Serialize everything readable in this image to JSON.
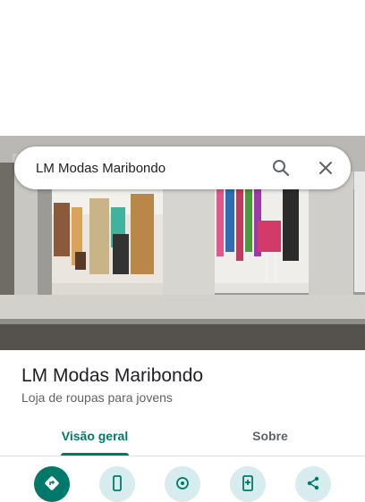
{
  "search": {
    "query": "LM Modas Maribondo"
  },
  "place": {
    "name": "LM Modas Maribondo",
    "category": "Loja de roupas para jovens"
  },
  "tabs": [
    {
      "label": "Visão geral",
      "active": true
    },
    {
      "label": "Sobre",
      "active": false
    }
  ],
  "actions": [
    {
      "icon": "directions-icon"
    },
    {
      "icon": "phone-icon"
    },
    {
      "icon": "location-pin-icon"
    },
    {
      "icon": "add-to-phone-icon"
    },
    {
      "icon": "share-icon"
    }
  ],
  "colors": {
    "accent": "#00796b",
    "action_bg": "#d7ecef",
    "text_primary": "#202124",
    "text_secondary": "#5f6368"
  }
}
